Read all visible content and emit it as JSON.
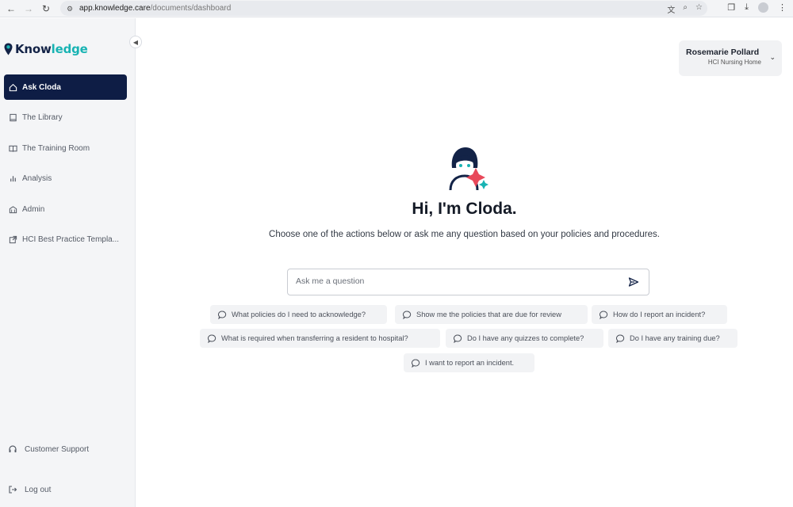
{
  "browser": {
    "url_host": "app.knowledge.care",
    "url_path": "/documents/dashboard"
  },
  "sidebar": {
    "logo_text": "Knowledge",
    "items": [
      {
        "label": "Ask Cloda",
        "icon": "home-icon",
        "active": true
      },
      {
        "label": "The Library",
        "icon": "book-icon",
        "active": false
      },
      {
        "label": "The Training Room",
        "icon": "open-book-icon",
        "active": false
      },
      {
        "label": "Analysis",
        "icon": "bar-chart-icon",
        "active": false
      },
      {
        "label": "Admin",
        "icon": "building-icon",
        "active": false
      },
      {
        "label": "HCI Best Practice Templa...",
        "icon": "external-link-icon",
        "active": false
      }
    ],
    "support_label": "Customer Support",
    "logout_label": "Log out"
  },
  "user": {
    "name": "Rosemarie Pollard",
    "organization": "HCI Nursing Home"
  },
  "main": {
    "greeting": "Hi, I'm Cloda.",
    "subtitle": "Choose one of the actions below or ask me any question based on your policies and procedures.",
    "ask_placeholder": "Ask me a question",
    "suggestions": [
      "What policies do I need to acknowledge?",
      "Show me the policies that are due for review",
      "How do I report an incident?",
      "What is required when transferring a resident to hospital?",
      "Do I have any quizzes to complete?",
      "Do I have any training due?",
      "I want to report an incident."
    ]
  },
  "colors": {
    "brand_navy": "#0e1d45",
    "brand_teal": "#18b3b3",
    "accent_red": "#e8485a"
  }
}
